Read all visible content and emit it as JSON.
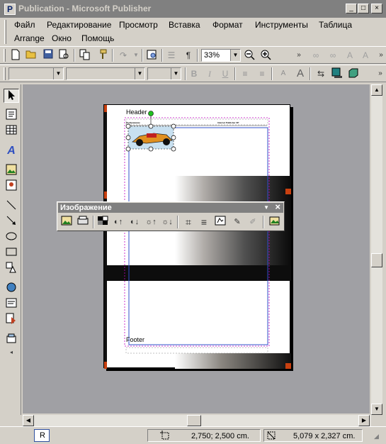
{
  "app": {
    "title": "Publication - Microsoft Publisher",
    "icon": "publisher-icon"
  },
  "window_controls": {
    "minimize": "_",
    "maximize": "□",
    "close": "×"
  },
  "menu": {
    "row1": [
      "Файл",
      "Редактирование",
      "Просмотр",
      "Вставка",
      "Формат",
      "Инструменты",
      "Таблица"
    ],
    "row2": [
      "Arrange",
      "Окно",
      "Помощь"
    ]
  },
  "standard_toolbar": {
    "zoom_value": "33%"
  },
  "picture_toolbar": {
    "title": "Изображение"
  },
  "page": {
    "header": "Header",
    "footer": "Footer",
    "tiny_text_left": "Изображение",
    "tiny_text_right": "Internet Publisher XP"
  },
  "status": {
    "page_number": "R",
    "position": "2,750; 2,500 cm.",
    "size": "5,079 x 2,327 cm."
  },
  "colors": {
    "accent_orange": "#c84010",
    "title_inactive": "#808080",
    "workspace": "#a0a0a4"
  }
}
